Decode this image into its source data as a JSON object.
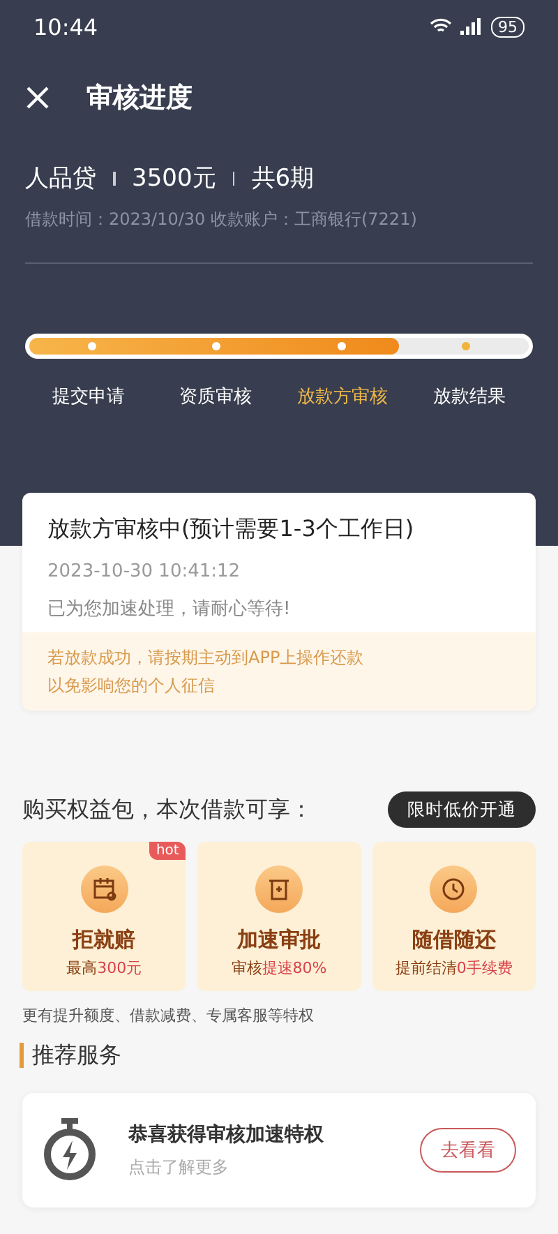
{
  "status_bar": {
    "time": "10:44",
    "battery": "95"
  },
  "header": {
    "title": "审核进度"
  },
  "loan": {
    "product": "人品贷",
    "amount": "3500元",
    "periods": "共6期",
    "detail": "借款时间：2023/10/30   收款账户：工商银行(7221)"
  },
  "progress": {
    "level": 0.74,
    "steps": [
      {
        "label": "提交申请",
        "selected": false
      },
      {
        "label": "资质审核",
        "selected": false
      },
      {
        "label": "放款方审核",
        "selected": true
      },
      {
        "label": "放款结果",
        "selected": false
      }
    ]
  },
  "status_card": {
    "title": "放款方审核中(预计需要1-3个工作日)",
    "time": "2023-10-30 10:41:12",
    "message": "已为您加速处理，请耐心等待!",
    "notice": [
      "若放款成功，请按期主动到APP上操作还款",
      "以免影响您的个人征信"
    ]
  },
  "benefits": {
    "title": "购买权益包，本次借款可享：",
    "button": "限时低价开通",
    "items": [
      {
        "kind": "calendar",
        "name": "拒就赔",
        "desc": "最高**300元**",
        "badge": "hot"
      },
      {
        "kind": "ticket",
        "name": "加速审批",
        "desc": "审核**提速80%**"
      },
      {
        "kind": "clock",
        "name": "随借随还",
        "desc": "提前结清**0手续费**"
      }
    ],
    "footnote": "更有提升额度、借款减费、专属客服等特权"
  },
  "recommend": {
    "title": "推荐服务",
    "card": {
      "title": "恭喜获得审核加速特权",
      "subtitle": "点击了解更多",
      "button": "去看看"
    }
  }
}
